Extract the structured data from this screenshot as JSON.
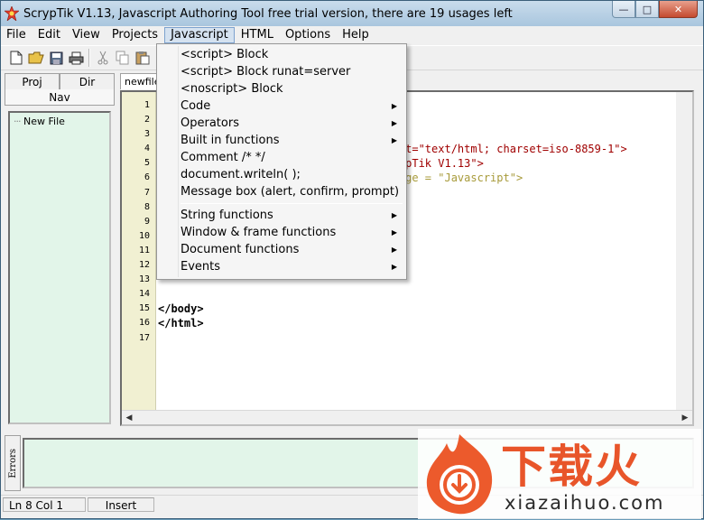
{
  "window": {
    "title": "ScrypTik V1.13, Javascript Authoring Tool free trial version, there are 19 usages left",
    "controls": {
      "minimize": "—",
      "maximize": "□",
      "close": "✕"
    }
  },
  "menubar": [
    "File",
    "Edit",
    "View",
    "Projects",
    "Javascript",
    "HTML",
    "Options",
    "Help"
  ],
  "active_menu": "Javascript",
  "toolbar": [
    "new-file",
    "open-folder",
    "save",
    "print",
    "cut",
    "copy",
    "paste"
  ],
  "left_panel": {
    "tabs": [
      "Proj",
      "Dir"
    ],
    "nav_label": "Nav",
    "tree": [
      {
        "label": "New File"
      }
    ]
  },
  "editor": {
    "tab": "newfile1",
    "line_numbers": [
      "1",
      "2",
      "3",
      "4",
      "5",
      "6",
      "7",
      "8",
      "9",
      "10",
      "11",
      "12",
      "13",
      "14",
      "15",
      "16",
      "17"
    ],
    "visible_code": {
      "line4_tail": "ontent=\"text/html; charset=iso-8859-1\">",
      "line5_tail": "\"ScrypTik V1.13\">",
      "line6_tail": "anguage = \"Javascript\">",
      "line15": "</body>",
      "line16": "</html>"
    }
  },
  "javascript_menu": {
    "group1": [
      {
        "label": "<script> Block",
        "submenu": false
      },
      {
        "label": "<script> Block runat=server",
        "submenu": false
      },
      {
        "label": "<noscript> Block",
        "submenu": false
      },
      {
        "label": "Code",
        "submenu": true
      },
      {
        "label": "Operators",
        "submenu": true
      },
      {
        "label": "Built in functions",
        "submenu": true
      },
      {
        "label": "Comment /*  */",
        "submenu": false
      },
      {
        "label": "document.writeln( );",
        "submenu": false
      },
      {
        "label": "Message box (alert, confirm, prompt)",
        "submenu": false
      }
    ],
    "group2": [
      {
        "label": "String functions",
        "submenu": true
      },
      {
        "label": "Window & frame functions",
        "submenu": true
      },
      {
        "label": "Document functions",
        "submenu": true
      },
      {
        "label": "Events",
        "submenu": true
      }
    ]
  },
  "errors_panel": {
    "label": "Errors"
  },
  "statusbar": {
    "position": "Ln 8 Col 1",
    "mode": "Insert"
  },
  "watermark": {
    "chinese": "下载火",
    "url": "xiazaihuo.com"
  },
  "colors": {
    "accent_menu": "#d5e2f0",
    "tree_bg": "#e2f5e9",
    "gutter_bg": "#f1f0d2",
    "watermark_orange": "#e8552a"
  }
}
